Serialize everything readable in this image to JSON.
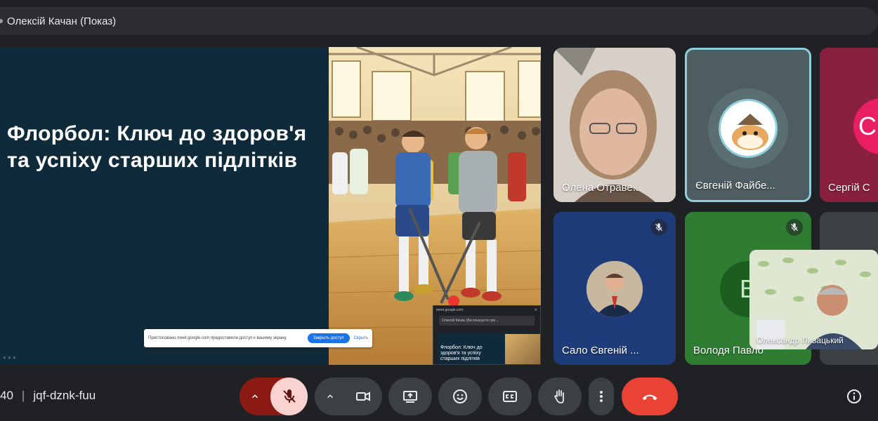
{
  "presenter_bar": {
    "title": "Олексій Качан (Показ)"
  },
  "slide": {
    "title": "Флорбол: Ключ до здоров'я та успіху старших підлітків",
    "image_icon": "floorball-players-illustration"
  },
  "share_popup": {
    "message": "Пристосовано meet.google.com предоставили доступ к вашему экрану.",
    "stop_label": "Закрыть доступ",
    "hide_label": "Скрыть"
  },
  "mini_preview": {
    "url": "meet.google.com",
    "tab_text": "Олексій Качан (Ви показуєте пре...",
    "slide_title": "Флорбол: Ключ до здоров'я та успіху старших підлітків"
  },
  "participants": [
    {
      "name": "Олена Отраве...",
      "color": "#b9b3ad"
    },
    {
      "name": "Євгеній Файбе...",
      "color": "#4e5d61",
      "speaking": true
    },
    {
      "name": "Сергій С",
      "color": "#8a2040",
      "initial": "С"
    },
    {
      "name": "Сало Євгеній ...",
      "color": "#1f3c7a",
      "muted": true
    },
    {
      "name": "Володя Павло",
      "color": "#2e7d32",
      "initial": "В",
      "muted": true
    },
    {
      "name": "Олександр Ливацький",
      "color": "#cfd8c0"
    }
  ],
  "bottom_bar": {
    "time_fragment": "40",
    "meeting_code": "jqf-dznk-fuu"
  },
  "icons": {
    "mic": "mic-off-icon",
    "camera": "videocam-icon",
    "present": "present-screen-icon",
    "emoji": "emoji-icon",
    "captions": "closed-captions-icon",
    "hand": "raise-hand-icon",
    "more": "more-vert-icon",
    "hangup": "call-end-icon",
    "info": "info-icon"
  },
  "colors": {
    "hangup": "#ea4335",
    "mic_off_bg": "#8b1a14",
    "speaking_border": "#8ecfdc"
  }
}
